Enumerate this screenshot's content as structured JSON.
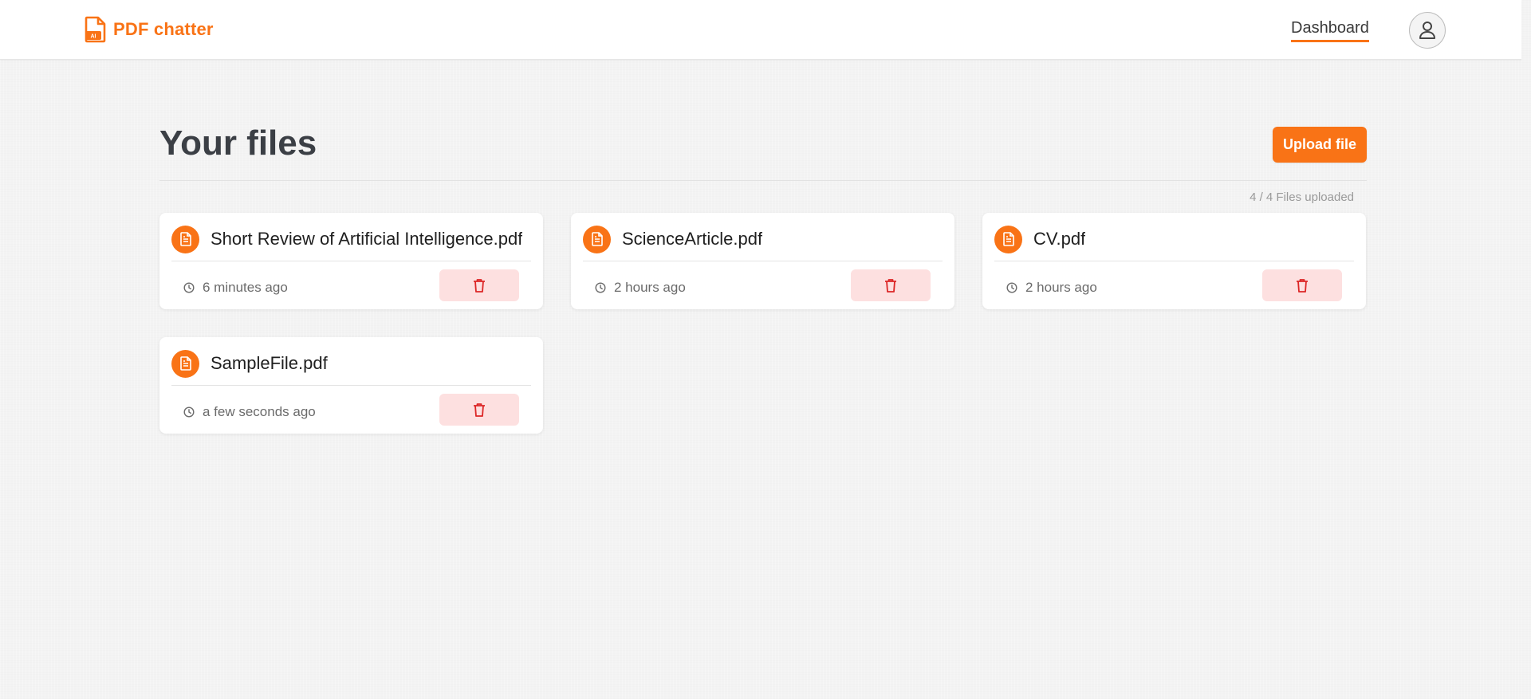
{
  "app": {
    "brand_name": "PDF chatter",
    "brand_icon": "pdf-file-icon",
    "accent_color": "#f97316"
  },
  "nav": {
    "dashboard_label": "Dashboard",
    "avatar_icon": "user-icon"
  },
  "main": {
    "title": "Your files",
    "upload_label": "Upload file",
    "files_count": "4 / 4 Files uploaded",
    "files": [
      {
        "name": "Short Review of Artificial Intelligence.pdf",
        "time": "6 minutes ago"
      },
      {
        "name": "ScienceArticle.pdf",
        "time": "2 hours ago"
      },
      {
        "name": "CV.pdf",
        "time": "2 hours ago"
      },
      {
        "name": "SampleFile.pdf",
        "time": "a few seconds ago"
      }
    ],
    "file_icon": "document-icon",
    "time_icon": "clock-icon",
    "delete_icon": "trash-icon",
    "delete_bg": "#fde0e0",
    "delete_color": "#dc2626"
  }
}
